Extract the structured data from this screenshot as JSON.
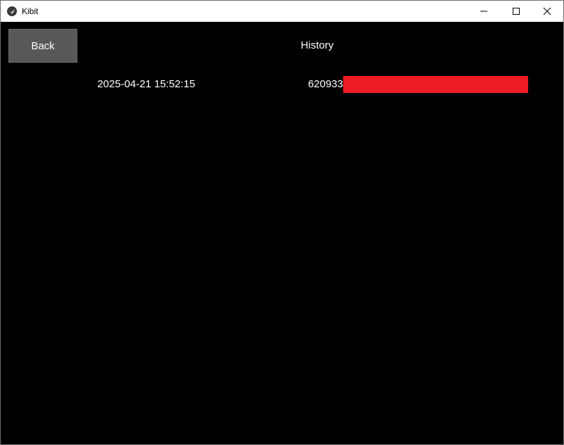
{
  "window": {
    "title": "Kibit",
    "icon": "kivy-logo-icon",
    "controls": [
      "minimize-icon",
      "maximize-icon",
      "close-icon"
    ]
  },
  "header": {
    "back_label": "Back",
    "title": "History"
  },
  "history": {
    "rows": [
      {
        "date": "2025-04-21 15:52:15",
        "value": "620933",
        "bar_fraction": 1.0,
        "bar_color": "#ed1c24"
      }
    ]
  },
  "colors": {
    "background": "#000000",
    "button": "#585858",
    "bar": "#ed1c24",
    "text": "#ffffff"
  }
}
